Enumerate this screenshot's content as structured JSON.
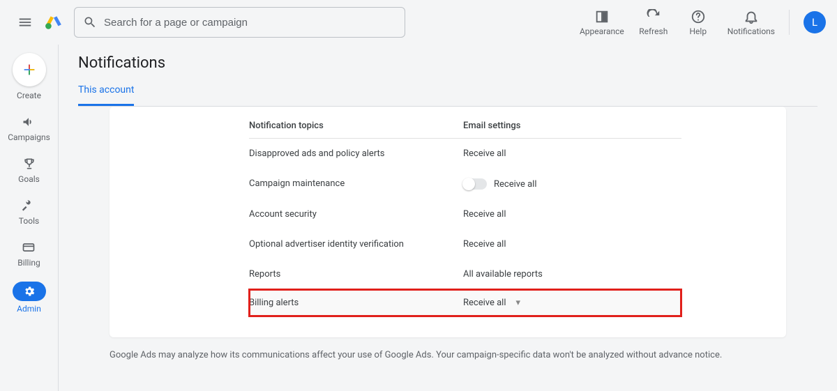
{
  "topbar": {
    "search_placeholder": "Search for a page or campaign",
    "actions": {
      "appearance": "Appearance",
      "refresh": "Refresh",
      "help": "Help",
      "notifications": "Notifications"
    },
    "avatar_initial": "L"
  },
  "leftnav": {
    "create": "Create",
    "campaigns": "Campaigns",
    "goals": "Goals",
    "tools": "Tools",
    "billing": "Billing",
    "admin": "Admin"
  },
  "page": {
    "title": "Notifications",
    "tab_this_account": "This account",
    "header_topics": "Notification topics",
    "header_email": "Email settings",
    "rows": {
      "disapproved": {
        "topic": "Disapproved ads and policy alerts",
        "setting": "Receive all"
      },
      "maintenance": {
        "topic": "Campaign maintenance",
        "setting": "Receive all"
      },
      "security": {
        "topic": "Account security",
        "setting": "Receive all"
      },
      "identity": {
        "topic": "Optional advertiser identity verification",
        "setting": "Receive all"
      },
      "reports": {
        "topic": "Reports",
        "setting": "All available reports"
      },
      "billing_alerts": {
        "topic": "Billing alerts",
        "setting": "Receive all"
      }
    },
    "footnote": "Google Ads may analyze how its communications affect your use of Google Ads. Your campaign-specific data won't be analyzed without advance notice."
  }
}
